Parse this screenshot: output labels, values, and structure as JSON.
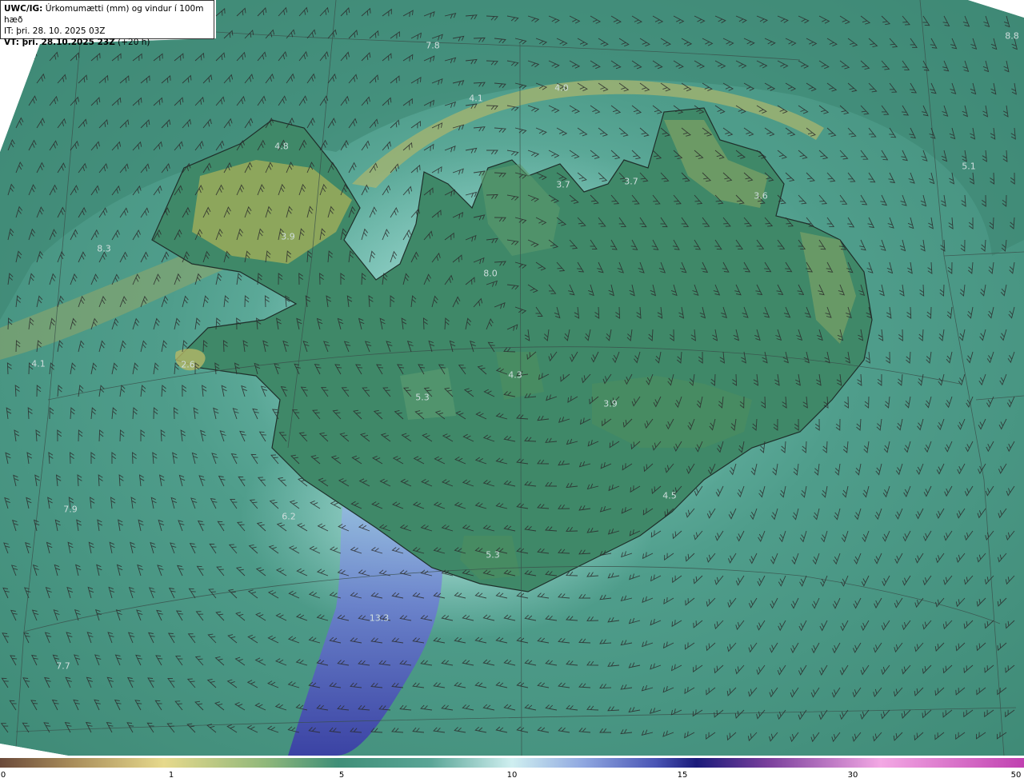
{
  "header": {
    "title_bold": "UWC/IG:",
    "title_rest": "Úrkomumætti (mm) og vindur í 100m hæð",
    "it_line": "IT: þri. 28. 10. 2025 03Z",
    "vt_bold": "VT: þri. 28.10.2025 23Z",
    "vt_rest": "(+20 h)"
  },
  "value_labels": [
    {
      "text": "7.8"
    },
    {
      "text": "8.8"
    },
    {
      "text": "4.1"
    },
    {
      "text": "4.0"
    },
    {
      "text": "4.8"
    },
    {
      "text": "3.7"
    },
    {
      "text": "3.7"
    },
    {
      "text": "3.6"
    },
    {
      "text": "5.1"
    },
    {
      "text": "3.9"
    },
    {
      "text": "8.3"
    },
    {
      "text": "8.0"
    },
    {
      "text": "4.1"
    },
    {
      "text": "2.6"
    },
    {
      "text": "4.3"
    },
    {
      "text": "5.3"
    },
    {
      "text": "3.9"
    },
    {
      "text": "4.5"
    },
    {
      "text": "7.9"
    },
    {
      "text": "6.2"
    },
    {
      "text": "5.3"
    },
    {
      "text": "13.3"
    },
    {
      "text": "7.7"
    }
  ],
  "colorbar": {
    "ticks": [
      "0",
      "1",
      "5",
      "10",
      "15",
      "30",
      "50"
    ],
    "colors": [
      "#6b4a3a",
      "#a88c5a",
      "#e6d98c",
      "#8fb77a",
      "#3f8f78",
      "#5aa596",
      "#a5dcd8",
      "#cfeff0",
      "#8fa7e0",
      "#4a55b5",
      "#1a1a7a",
      "#7a3f9c",
      "#c27ad0",
      "#f3a8e4",
      "#e06acd"
    ]
  }
}
